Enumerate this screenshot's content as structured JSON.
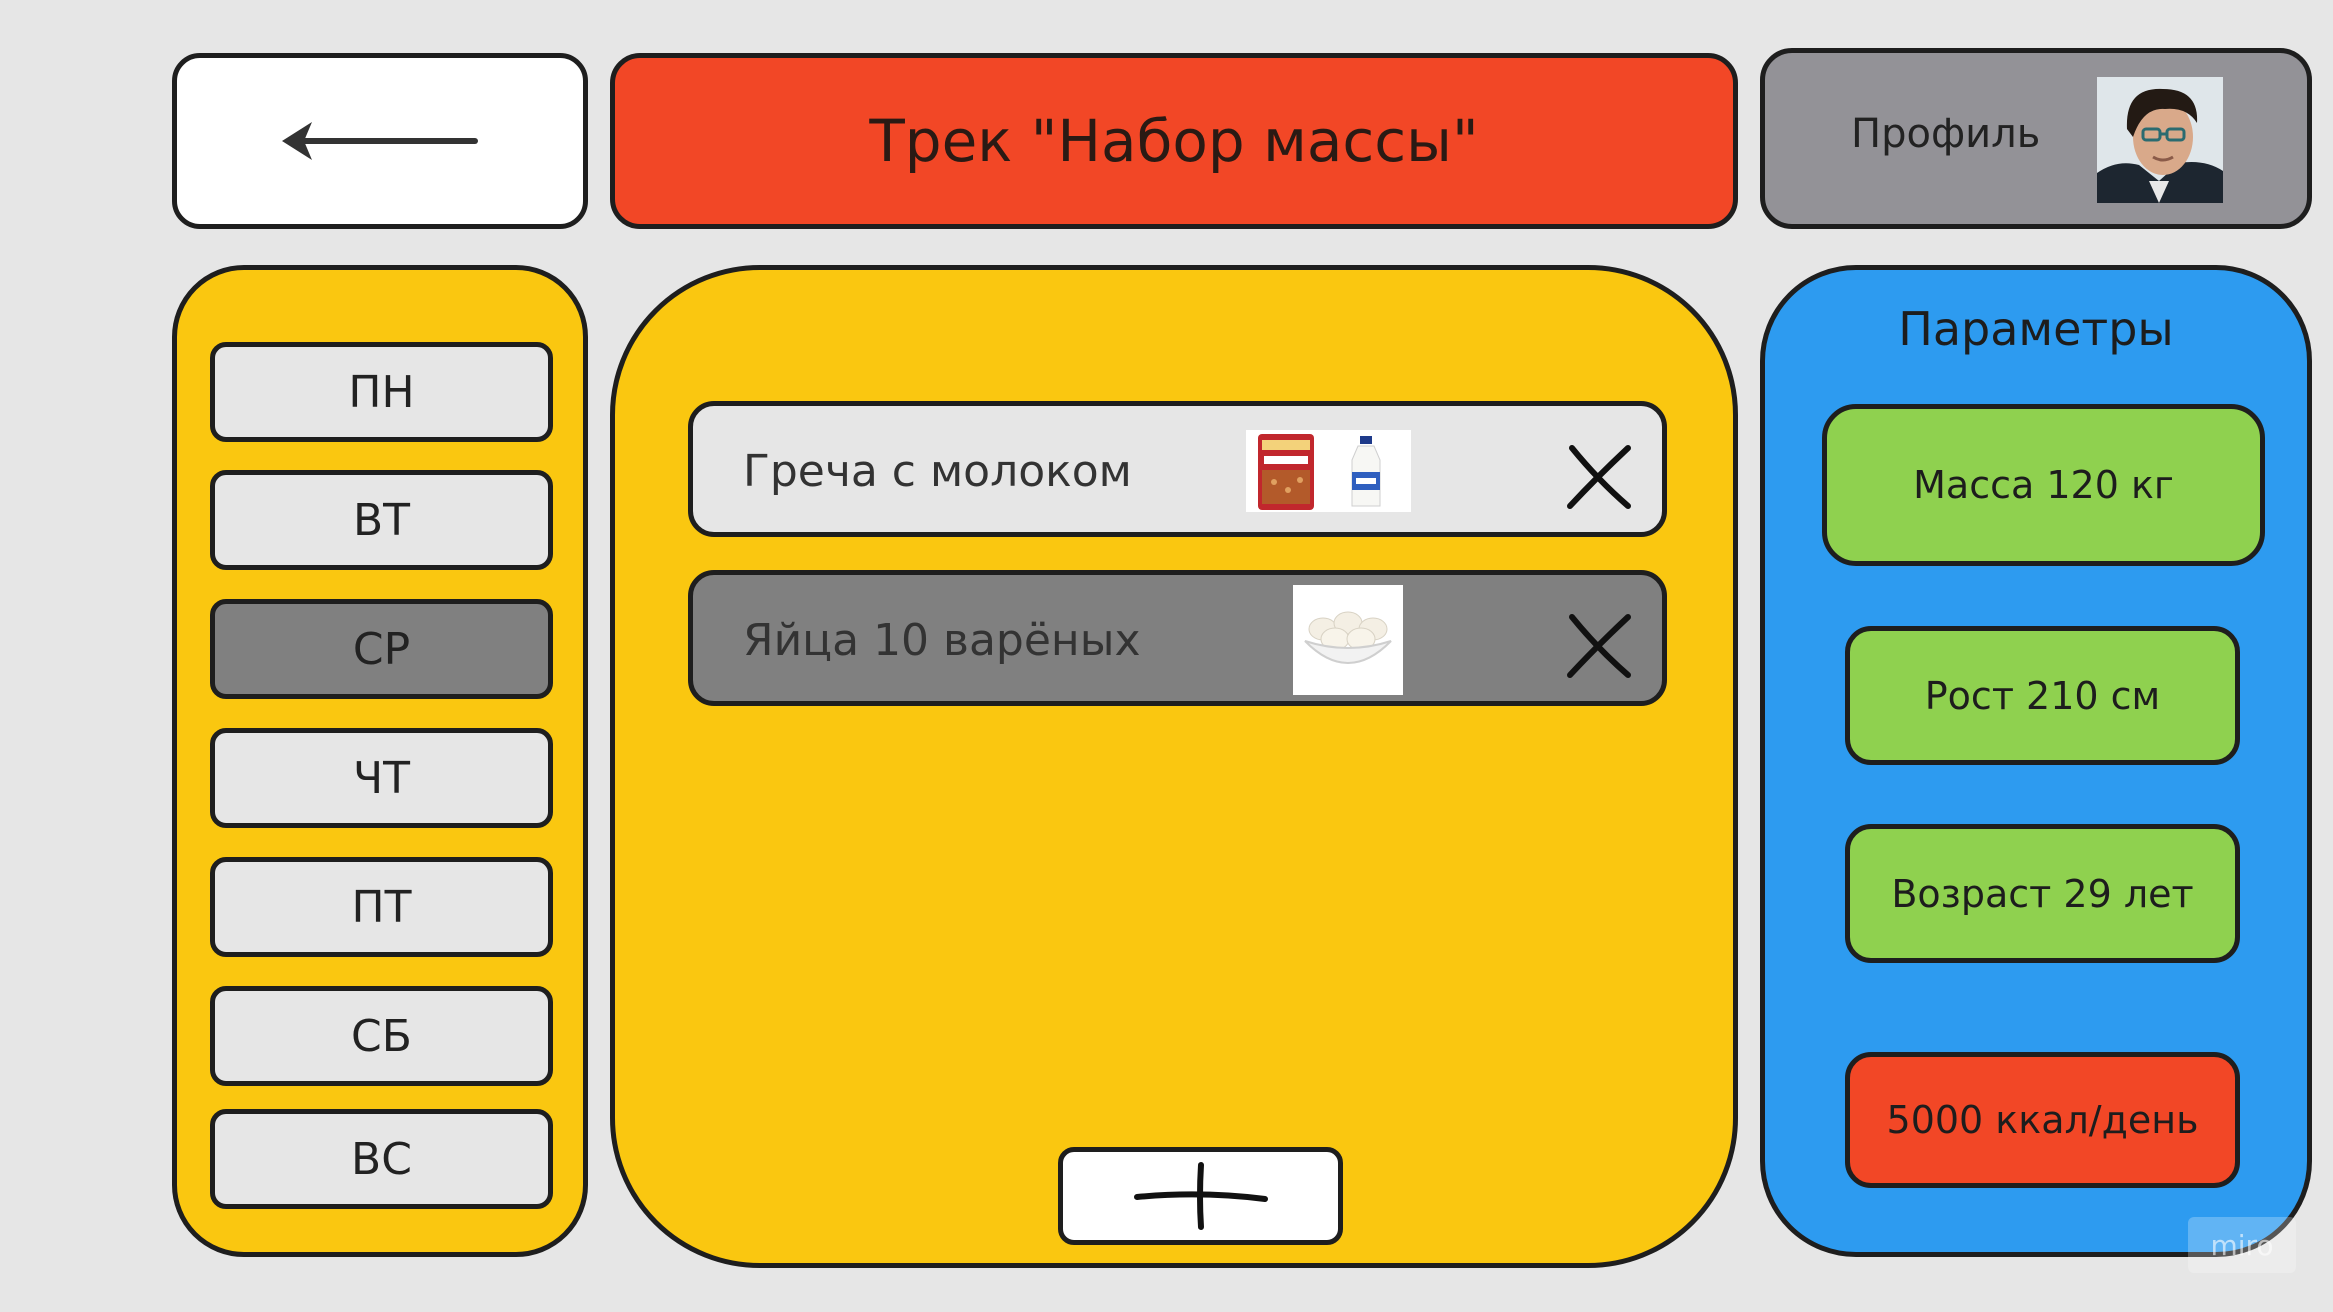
{
  "header": {
    "back_icon": "arrow-left-icon",
    "title": "Трек \"Набор массы\"",
    "profile_label": "Профиль",
    "accent_color": "#f24726"
  },
  "days": {
    "items": [
      {
        "label": "ПН",
        "active": false
      },
      {
        "label": "ВТ",
        "active": false
      },
      {
        "label": "СР",
        "active": true
      },
      {
        "label": "ЧТ",
        "active": false
      },
      {
        "label": "ПТ",
        "active": false
      },
      {
        "label": "СБ",
        "active": false
      },
      {
        "label": "ВС",
        "active": false
      }
    ]
  },
  "meals": {
    "items": [
      {
        "name": "Греча с молоком",
        "images": [
          "buckwheat-pack-icon",
          "milk-bottle-icon"
        ],
        "remove_icon": "close-icon"
      },
      {
        "name": "Яйца 10 варёных",
        "images": [
          "eggs-bowl-icon"
        ],
        "remove_icon": "close-icon"
      }
    ],
    "add_icon": "plus-icon"
  },
  "params": {
    "title": "Параметры",
    "mass": "Масса 120 кг",
    "height": "Рост 210 см",
    "age": "Возраст 29 лет",
    "calories": "5000 ккал/день"
  },
  "colors": {
    "panel_yellow": "#fac710",
    "panel_blue": "#2d9bf0",
    "param_green": "#8fd14f",
    "profile_gray": "#939297"
  },
  "watermark": "miro"
}
